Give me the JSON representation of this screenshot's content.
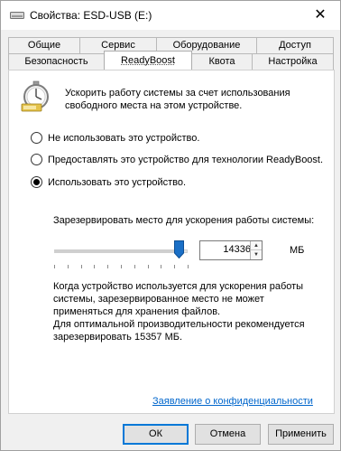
{
  "window": {
    "title": "Свойства: ESD-USB (E:)",
    "close_glyph": "✕"
  },
  "tabs": {
    "row1": [
      "Общие",
      "Сервис",
      "Оборудование",
      "Доступ"
    ],
    "row2": [
      "Безопасность",
      "ReadyBoost",
      "Квота",
      "Настройка"
    ],
    "active": "ReadyBoost"
  },
  "readyboost": {
    "intro": "Ускорить работу системы за счет использования свободного места на этом устройстве.",
    "options": [
      {
        "label": "Не использовать это устройство.",
        "checked": false
      },
      {
        "label": "Предоставлять это устройство для технологии ReadyBoost.",
        "checked": false
      },
      {
        "label": "Использовать это устройство.",
        "checked": true
      }
    ],
    "reserve_label": "Зарезервировать место для ускорения работы системы:",
    "reserve_value": "14336",
    "reserve_max": 15357,
    "unit": "МБ",
    "note1": "Когда устройство используется для ускорения работы системы, зарезервированное место не может применяться для хранения файлов.",
    "note2": "Для оптимальной производительности рекомендуется зарезервировать 15357 МБ.",
    "privacy_link": "Заявление о конфиденциальности"
  },
  "buttons": {
    "ok": "ОК",
    "cancel": "Отмена",
    "apply": "Применить"
  },
  "colors": {
    "accent": "#0078d7",
    "link": "#0066cc",
    "slider_thumb": "#1a6fc6"
  },
  "icons": [
    "drive-icon",
    "close-icon",
    "readyboost-stopwatch-icon",
    "slider-thumb-icon",
    "spin-up-icon",
    "spin-down-icon"
  ]
}
